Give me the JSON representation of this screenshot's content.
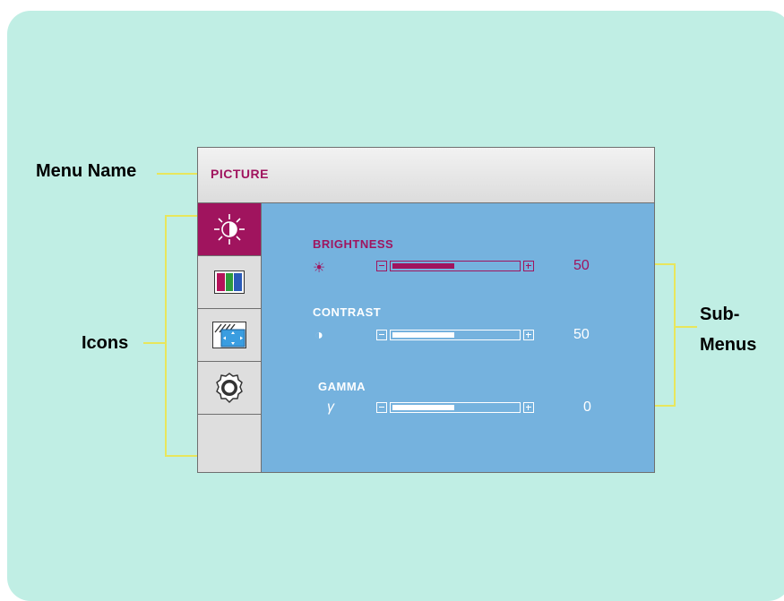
{
  "callouts": {
    "menu_name": "Menu Name",
    "icons": "Icons",
    "sub_menus_line1": "Sub-",
    "sub_menus_line2": "Menus"
  },
  "osd": {
    "title": "PICTURE",
    "icons": [
      "brightness-contrast-icon",
      "color-bars-icon",
      "screen-position-icon",
      "setup-gear-icon"
    ],
    "items": [
      {
        "label": "BRIGHTNESS",
        "symbol": "☀",
        "value": "50",
        "level": 0.5,
        "selected": true
      },
      {
        "label": "CONTRAST",
        "symbol": "◑",
        "value": "50",
        "level": 0.5,
        "selected": false
      },
      {
        "label": "GAMMA",
        "symbol": "γ",
        "value": "0",
        "level": 0.5,
        "selected": false
      }
    ]
  },
  "colors": {
    "panel_bg": "#c0eee4",
    "selected_magenta": "#a0145e",
    "content_blue": "#75b2de",
    "white": "#ffffff",
    "callout_line": "#e8e65c"
  }
}
